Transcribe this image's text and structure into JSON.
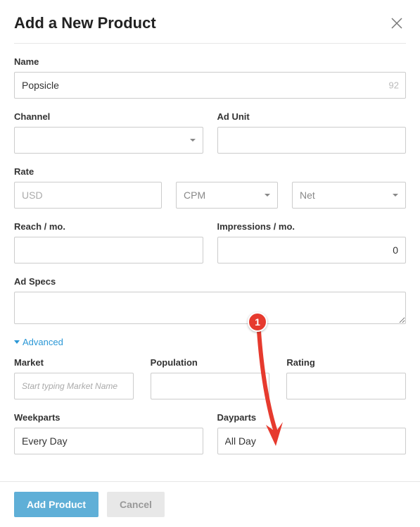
{
  "header": {
    "title": "Add a New Product"
  },
  "labels": {
    "name": "Name",
    "channel": "Channel",
    "adUnit": "Ad Unit",
    "rate": "Rate",
    "reach": "Reach / mo.",
    "impressions": "Impressions / mo.",
    "adSpecs": "Ad Specs",
    "advanced": "Advanced",
    "market": "Market",
    "population": "Population",
    "rating": "Rating",
    "weekparts": "Weekparts",
    "dayparts": "Dayparts"
  },
  "values": {
    "name": "Popsicle",
    "nameCounter": "92",
    "rateCurrency": "USD",
    "rateModel": "CPM",
    "rateType": "Net",
    "impressions": "0",
    "marketPlaceholder": "Start typing Market Name",
    "weekparts": "Every Day",
    "dayparts": "All Day"
  },
  "buttons": {
    "submit": "Add Product",
    "cancel": "Cancel"
  },
  "annotation": {
    "badge": "1"
  }
}
